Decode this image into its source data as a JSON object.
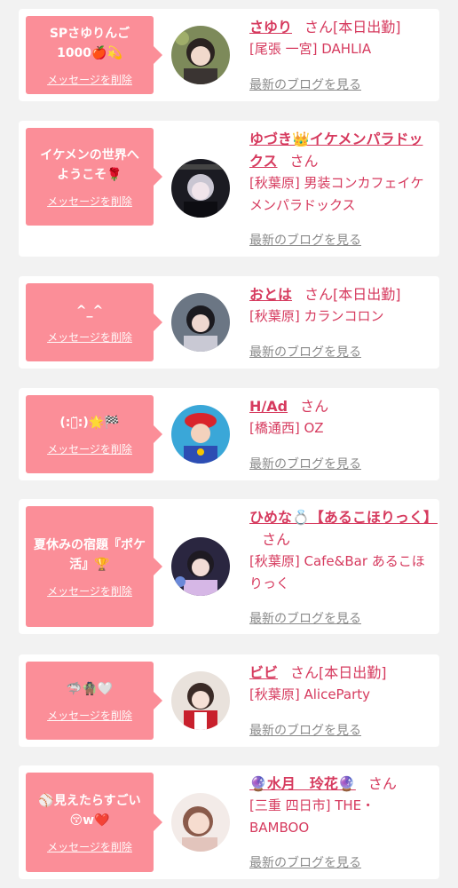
{
  "items": [
    {
      "message": "SPさゆりんご\n1000🍎💫",
      "delete_label": "メッセージを削除",
      "name": "さゆり",
      "honorific": "さん",
      "status": "[本日出勤]",
      "shop": "[尾張 一宮] DAHLIA",
      "blog_label": "最新のブログを見る"
    },
    {
      "message": "イケメンの世界へ\nようこそ🌹",
      "delete_label": "メッセージを削除",
      "name": "ゆづき👑イケメンパラドックス",
      "honorific": "さん",
      "status": "",
      "shop": "[秋葉原] 男装コンカフェイケメンパラドックス",
      "blog_label": "最新のブログを見る"
    },
    {
      "message": "^_^",
      "delete_label": "メッセージを削除",
      "name": "おとは",
      "honorific": "さん",
      "status": "[本日出勤]",
      "shop": "[秋葉原] カランコロン",
      "blog_label": "最新のブログを見る"
    },
    {
      "message": "(:ꈍ̆:)🌟🏁",
      "delete_label": "メッセージを削除",
      "name": "H/Ad",
      "honorific": "さん",
      "status": "",
      "shop": "[橋通西] OZ",
      "blog_label": "最新のブログを見る"
    },
    {
      "message": "夏休みの宿題『ポケ活』🏆",
      "delete_label": "メッセージを削除",
      "name": "ひめな💍【あるこほりっく】",
      "honorific": "さん",
      "status": "",
      "shop": "[秋葉原] Cafe&Bar あるこほりっく",
      "blog_label": "最新のブログを見る"
    },
    {
      "message": "🦈🧌🤍",
      "delete_label": "メッセージを削除",
      "name": "ビビ",
      "honorific": "さん",
      "status": "[本日出勤]",
      "shop": "[秋葉原] AliceParty",
      "blog_label": "最新のブログを見る"
    },
    {
      "message": "⚾見えたらすごい\n😚w❤️",
      "delete_label": "メッセージを削除",
      "name": "🔮水月　玲花🔮",
      "honorific": "さん",
      "status": "",
      "shop": "[三重 四日市] THE・BAMBOO",
      "blog_label": "最新のブログを見る"
    }
  ],
  "colors": {
    "bubble": "#fb8e98",
    "name": "#d63a5e",
    "blog_link": "#8a8a8a",
    "background": "#f2f2f2"
  }
}
